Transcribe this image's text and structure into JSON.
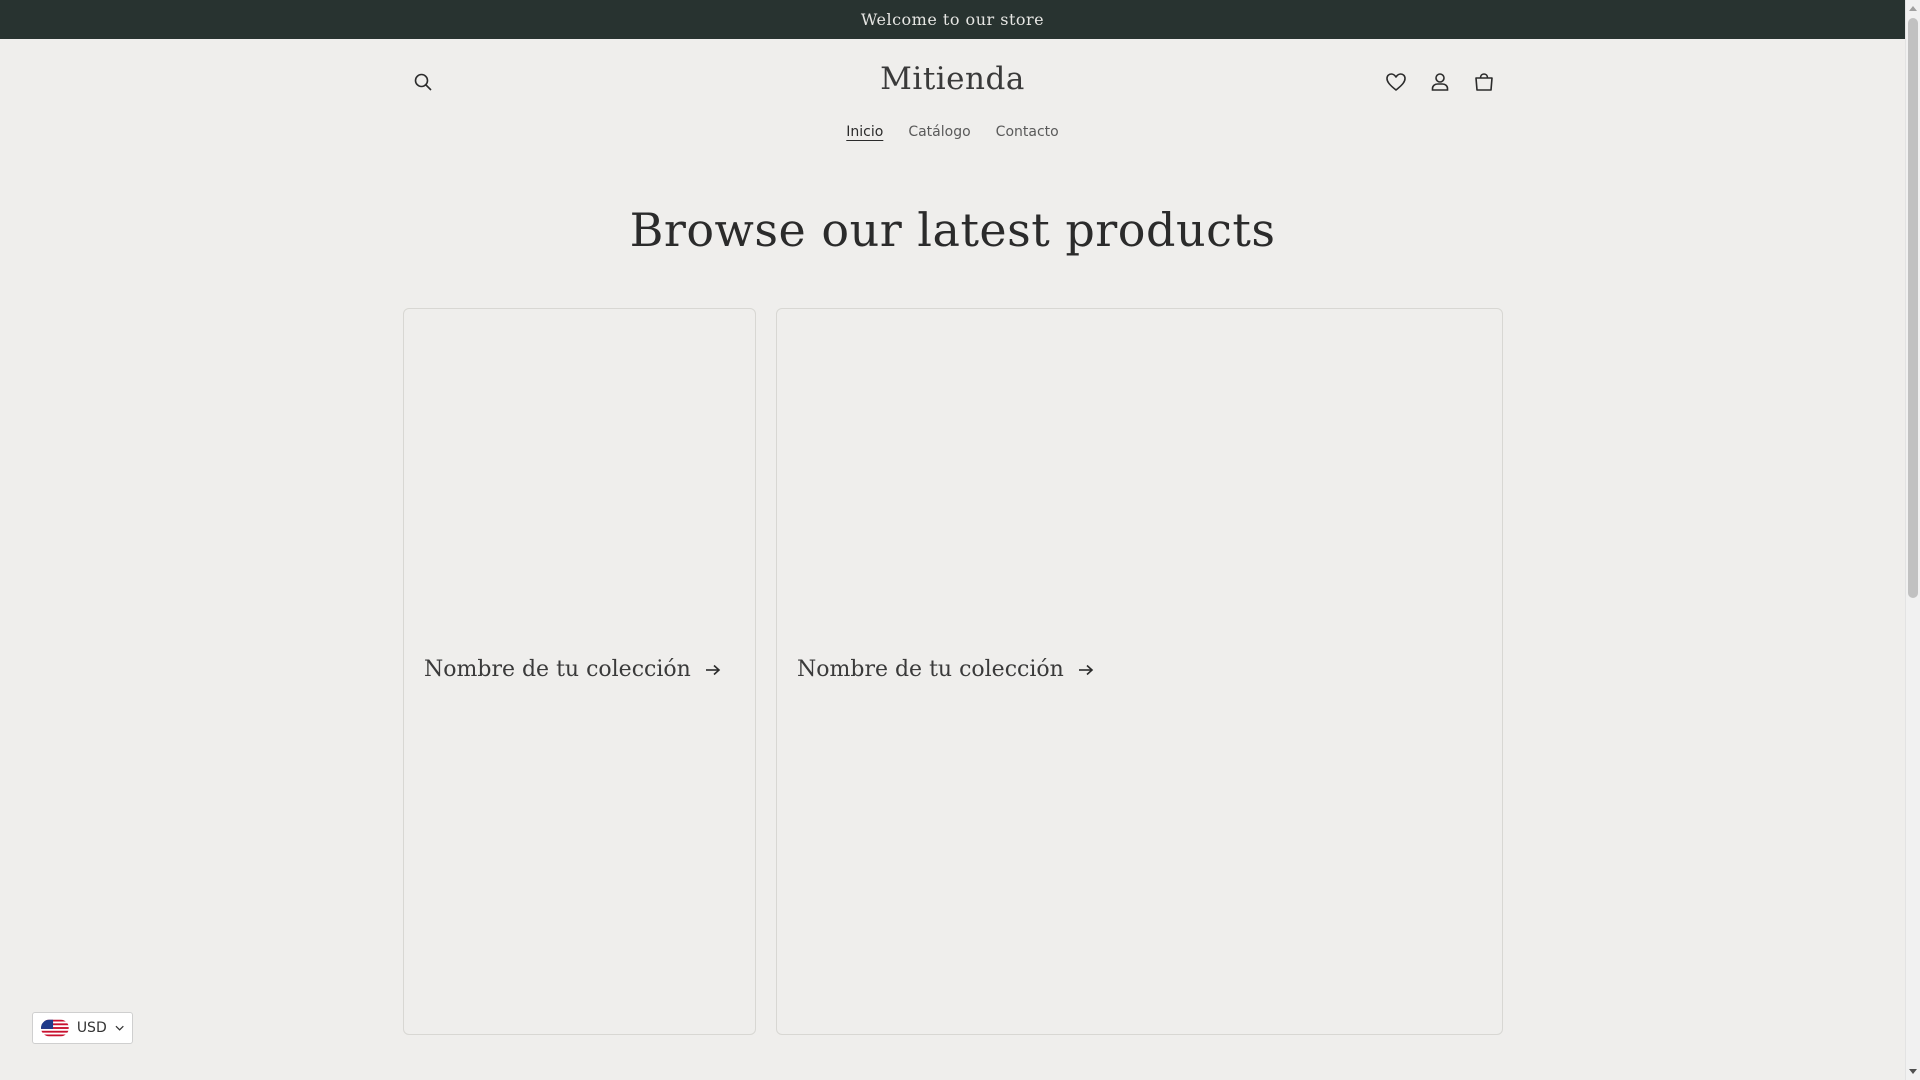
{
  "announcement": {
    "text": "Welcome to our store"
  },
  "header": {
    "logo": "Mitienda",
    "icons": {
      "search": "search-icon",
      "wishlist": "heart-icon",
      "account": "user-icon",
      "cart": "cart-icon"
    }
  },
  "nav": {
    "items": [
      {
        "label": "Inicio",
        "active": true
      },
      {
        "label": "Catálogo",
        "active": false
      },
      {
        "label": "Contacto",
        "active": false
      }
    ]
  },
  "section": {
    "title": "Browse our latest products"
  },
  "collections": [
    {
      "title": "Nombre de tu colección"
    },
    {
      "title": "Nombre de tu colección"
    }
  ],
  "currency": {
    "code": "USD",
    "flag": "us-flag-icon"
  },
  "colors": {
    "announcement_bg": "#283330",
    "page_bg": "#efeeec",
    "text": "#2b2b2b",
    "card_border": "#d8d7d3"
  }
}
